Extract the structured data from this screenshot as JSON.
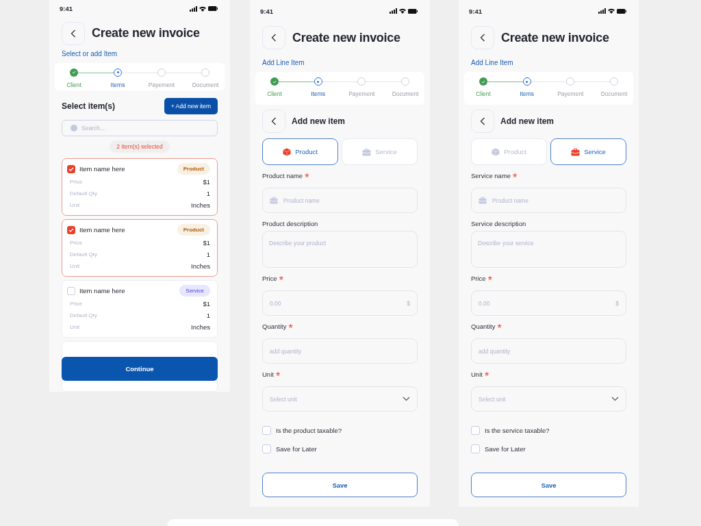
{
  "screens": [
    {
      "kind": "list",
      "time": "9:41",
      "title": "Create new invoice",
      "subtitle": "Select or add Item",
      "steps": [
        {
          "label": "Client",
          "done": true,
          "selected": false
        },
        {
          "label": "Items",
          "done": false,
          "selected": true
        },
        {
          "label": "Payement",
          "done": false,
          "selected": false
        },
        {
          "label": "Document",
          "done": false,
          "selected": false
        }
      ],
      "section_title": "Select item(s)",
      "add_button": "+ Add new item",
      "search_placeholder": "Search...",
      "selected_count": "2 Item(s) selected",
      "items": [
        {
          "name": "Item name here",
          "checked": true,
          "kind": "product",
          "badge": "Product",
          "rows": [
            {
              "label": "Price",
              "value": "$1"
            },
            {
              "label": "Default Qty",
              "value": "1"
            },
            {
              "label": "Unit",
              "value": "Inches"
            }
          ]
        },
        {
          "name": "Item name here",
          "checked": true,
          "kind": "product",
          "badge": "Product",
          "rows": [
            {
              "label": "Price",
              "value": "$1"
            },
            {
              "label": "Default Qty",
              "value": "1"
            },
            {
              "label": "Unit",
              "value": "Inches"
            }
          ]
        },
        {
          "name": "Item name here",
          "checked": false,
          "kind": "service",
          "badge": "Service",
          "rows": [
            {
              "label": "Price",
              "value": "$1"
            },
            {
              "label": "Default Qty",
              "value": "1"
            },
            {
              "label": "Unit",
              "value": "Inches"
            }
          ]
        }
      ],
      "continue_button": "Continue"
    },
    {
      "kind": "form",
      "time": "9:41",
      "title": "Create new invoice",
      "subtitle": "Add Line Item",
      "steps": [
        {
          "label": "Client",
          "done": true,
          "selected": false
        },
        {
          "label": "Items",
          "done": false,
          "selected": true
        },
        {
          "label": "Payement",
          "done": false,
          "selected": false
        },
        {
          "label": "Document",
          "done": false,
          "selected": false
        }
      ],
      "form_title": "Add new item",
      "tabs": [
        {
          "label": "Product",
          "kind": "product",
          "selected": true
        },
        {
          "label": "Service",
          "kind": "service",
          "selected": false
        }
      ],
      "fields": [
        {
          "kind": "text",
          "label": "Product name",
          "required_mark": "*",
          "placeholder": "Product name",
          "icon": true
        },
        {
          "kind": "textarea",
          "label": "Product description",
          "placeholder": "Describe your product"
        },
        {
          "kind": "price",
          "label": "Price",
          "required_mark": "*",
          "placeholder": "0.00",
          "suffix": "$"
        },
        {
          "kind": "text",
          "label": "Quantity",
          "required_mark": "*",
          "placeholder": "add quantity",
          "icon": false
        },
        {
          "kind": "select",
          "label": "Unit",
          "required_mark": "*",
          "placeholder": "Select unit"
        }
      ],
      "checkboxes": [
        {
          "label": "Is the product taxable?",
          "checked": false
        },
        {
          "label": "Save for Later",
          "checked": false
        }
      ],
      "save_button": "Save"
    },
    {
      "kind": "form",
      "time": "9:41",
      "title": "Create new invoice",
      "subtitle": "Add Line Item",
      "steps": [
        {
          "label": "Client",
          "done": true,
          "selected": false
        },
        {
          "label": "Items",
          "done": false,
          "selected": true
        },
        {
          "label": "Payement",
          "done": false,
          "selected": false
        },
        {
          "label": "Document",
          "done": false,
          "selected": false
        }
      ],
      "form_title": "Add new item",
      "tabs": [
        {
          "label": "Product",
          "kind": "product",
          "selected": false
        },
        {
          "label": "Service",
          "kind": "service",
          "selected": true
        }
      ],
      "fields": [
        {
          "kind": "text",
          "label": "Service name",
          "required_mark": "*",
          "placeholder": "Product name",
          "icon": true
        },
        {
          "kind": "textarea",
          "label": "Service description",
          "placeholder": "Describe your service"
        },
        {
          "kind": "price",
          "label": "Price",
          "required_mark": "*",
          "placeholder": "0.00",
          "suffix": "$"
        },
        {
          "kind": "text",
          "label": "Quantity",
          "required_mark": "*",
          "placeholder": "add quantity",
          "icon": false
        },
        {
          "kind": "select",
          "label": "Unit",
          "required_mark": "*",
          "placeholder": "Select unit"
        }
      ],
      "checkboxes": [
        {
          "label": "Is the service taxable?",
          "checked": false
        },
        {
          "label": "Save for Later",
          "checked": false
        }
      ],
      "save_button": "Save"
    }
  ]
}
